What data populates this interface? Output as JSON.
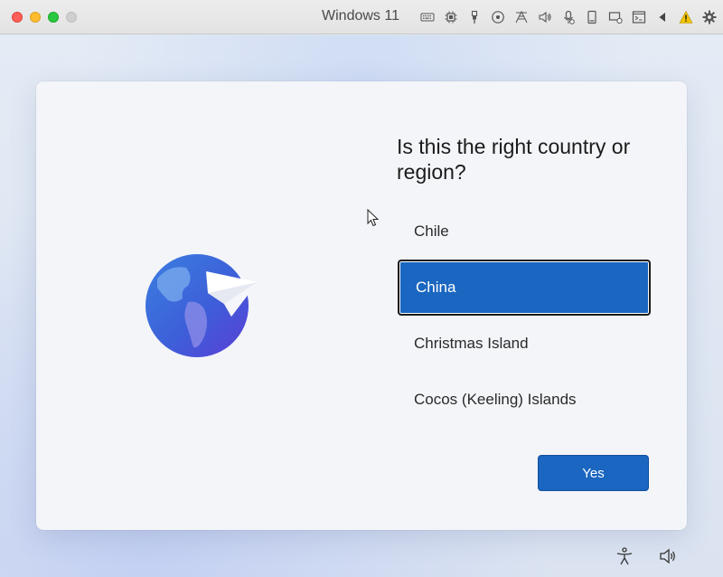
{
  "window": {
    "title": "Windows 11",
    "toolbar_icons": [
      "keyboard-icon",
      "cpu-icon",
      "usb-icon",
      "cd-icon",
      "network-icon",
      "speaker-icon",
      "microphone-icon",
      "storage-icon",
      "display-icon",
      "terminal-icon",
      "collapse-arrow-icon",
      "warning-icon",
      "settings-icon"
    ]
  },
  "oobe": {
    "question": "Is this the right country or region?",
    "countries": [
      {
        "label": "Chile",
        "selected": false
      },
      {
        "label": "China",
        "selected": true
      },
      {
        "label": "Christmas Island",
        "selected": false
      },
      {
        "label": "Cocos (Keeling) Islands",
        "selected": false
      }
    ],
    "yes_label": "Yes"
  },
  "footer_icons": [
    "accessibility-icon",
    "volume-icon"
  ],
  "colors": {
    "accent": "#1a66c0",
    "card_bg": "#f3f5f9",
    "warning": "#f5c400"
  }
}
